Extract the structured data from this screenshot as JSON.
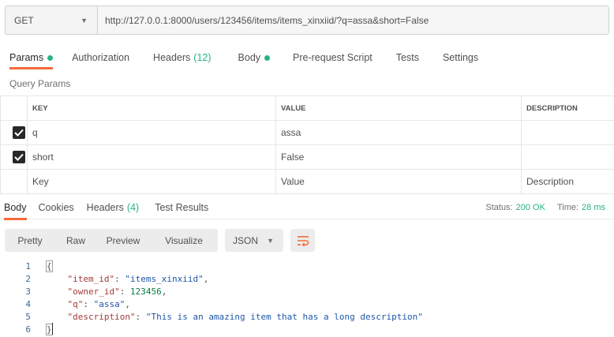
{
  "request": {
    "method": "GET",
    "url": "http://127.0.0.1:8000/users/123456/items/items_xinxiid/?q=assa&short=False"
  },
  "request_tabs": [
    {
      "label": "Params",
      "dot": true,
      "count": "",
      "active": true
    },
    {
      "label": "Authorization",
      "dot": false,
      "count": "",
      "active": false
    },
    {
      "label": "Headers",
      "dot": false,
      "count": "(12)",
      "active": false
    },
    {
      "label": "Body",
      "dot": true,
      "count": "",
      "active": false
    },
    {
      "label": "Pre-request Script",
      "dot": false,
      "count": "",
      "active": false
    },
    {
      "label": "Tests",
      "dot": false,
      "count": "",
      "active": false
    },
    {
      "label": "Settings",
      "dot": false,
      "count": "",
      "active": false
    }
  ],
  "query_params": {
    "label": "Query Params",
    "headers": {
      "key": "KEY",
      "value": "VALUE",
      "description": "DESCRIPTION"
    },
    "rows": [
      {
        "checked": true,
        "key": "q",
        "value": "assa",
        "description": ""
      },
      {
        "checked": true,
        "key": "short",
        "value": "False",
        "description": ""
      }
    ],
    "placeholders": {
      "key": "Key",
      "value": "Value",
      "description": "Description"
    }
  },
  "response_tabs": [
    {
      "label": "Body",
      "count": "",
      "active": true
    },
    {
      "label": "Cookies",
      "count": "",
      "active": false
    },
    {
      "label": "Headers",
      "count": "(4)",
      "active": false
    },
    {
      "label": "Test Results",
      "count": "",
      "active": false
    }
  ],
  "response_status": {
    "status_label": "Status:",
    "status_value": "200 OK",
    "time_label": "Time:",
    "time_value": "28 ms"
  },
  "view_modes": [
    "Pretty",
    "Raw",
    "Preview",
    "Visualize"
  ],
  "format": "JSON",
  "code_lines": [
    {
      "num": "1",
      "text": "{"
    },
    {
      "num": "2",
      "key": "\"item_id\"",
      "value": "\"items_xinxiid\"",
      "type": "string",
      "trail": ","
    },
    {
      "num": "3",
      "key": "\"owner_id\"",
      "value": "123456",
      "type": "number",
      "trail": ","
    },
    {
      "num": "4",
      "key": "\"q\"",
      "value": "\"assa\"",
      "type": "string",
      "trail": ","
    },
    {
      "num": "5",
      "key": "\"description\"",
      "value": "\"This is an amazing item that has a long description\"",
      "type": "string",
      "trail": ""
    },
    {
      "num": "6",
      "text": "}"
    }
  ],
  "colors": {
    "accent": "#f26b3a",
    "success": "#26b47f"
  }
}
